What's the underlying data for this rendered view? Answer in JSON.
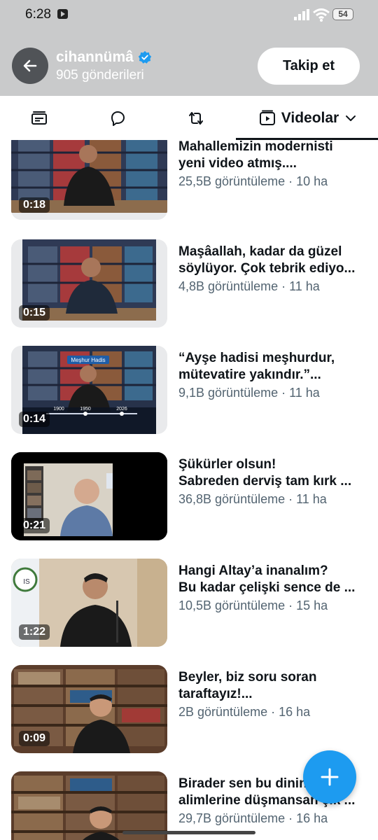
{
  "status_bar": {
    "time": "6:28",
    "battery": "54",
    "icons": [
      "youtube-notification-icon",
      "signal-icon",
      "wifi-icon",
      "battery-icon"
    ]
  },
  "header": {
    "profile_name": "cihannümâ",
    "post_count": "905 gönderileri",
    "follow_label": "Takip et",
    "back_icon": "arrow-left-icon",
    "verified_icon": "verified-badge-icon"
  },
  "tabs": {
    "media_icon": "media-icon",
    "replies_icon": "reply-bubble-icon",
    "reposts_icon": "repost-icon",
    "active_label": "Videolar",
    "active_icon": "video-play-icon",
    "dropdown_icon": "chevron-down-icon"
  },
  "videos": [
    {
      "title_line1": "Mahallemizin modernisti",
      "title_line2": "yeni video atmış....",
      "views": "25,5B görüntüleme",
      "age": "10 ha",
      "duration": "0:18"
    },
    {
      "title_line1": "Maşâallah, kadar da güzel",
      "title_line2": "söylüyor. Çok tebrik ediyo...",
      "views": "4,8B görüntüleme",
      "age": "11 ha",
      "duration": "0:15"
    },
    {
      "title_line1": "“Ayşe hadisi meşhurdur,",
      "title_line2": "mütevatire yakındır.”...",
      "views": "9,1B görüntüleme",
      "age": "11 ha",
      "duration": "0:14"
    },
    {
      "title_line1": "Şükürler olsun!",
      "title_line2": "Sabreden derviş tam kırk ...",
      "views": "36,8B görüntüleme",
      "age": "11 ha",
      "duration": "0:21"
    },
    {
      "title_line1": "Hangi Altay’a inanalım?",
      "title_line2": "Bu kadar çelişki sence de ...",
      "views": "10,5B görüntüleme",
      "age": "15 ha",
      "duration": "1:22"
    },
    {
      "title_line1": "Beyler, biz soru soran",
      "title_line2": "taraftayız!...",
      "views": "2B görüntüleme",
      "age": "16 ha",
      "duration": "0:09"
    },
    {
      "title_line1": "Birader sen bu dinin",
      "title_line2": "alimlerine düşmansan çık ...",
      "views": "29,7B görüntüleme",
      "age": "16 ha",
      "duration": ""
    }
  ],
  "thumb3_overlay": {
    "badge": "Meşhur Hadis",
    "years": [
      "1900",
      "1950",
      "2026"
    ]
  },
  "thumb5_overlay": {
    "logo_text": "IS"
  },
  "fab_icon": "plus-icon",
  "colors": {
    "accent": "#1d9bf0",
    "header_bg": "#c9cacb",
    "text": "#0f1419",
    "secondary": "#536471"
  }
}
